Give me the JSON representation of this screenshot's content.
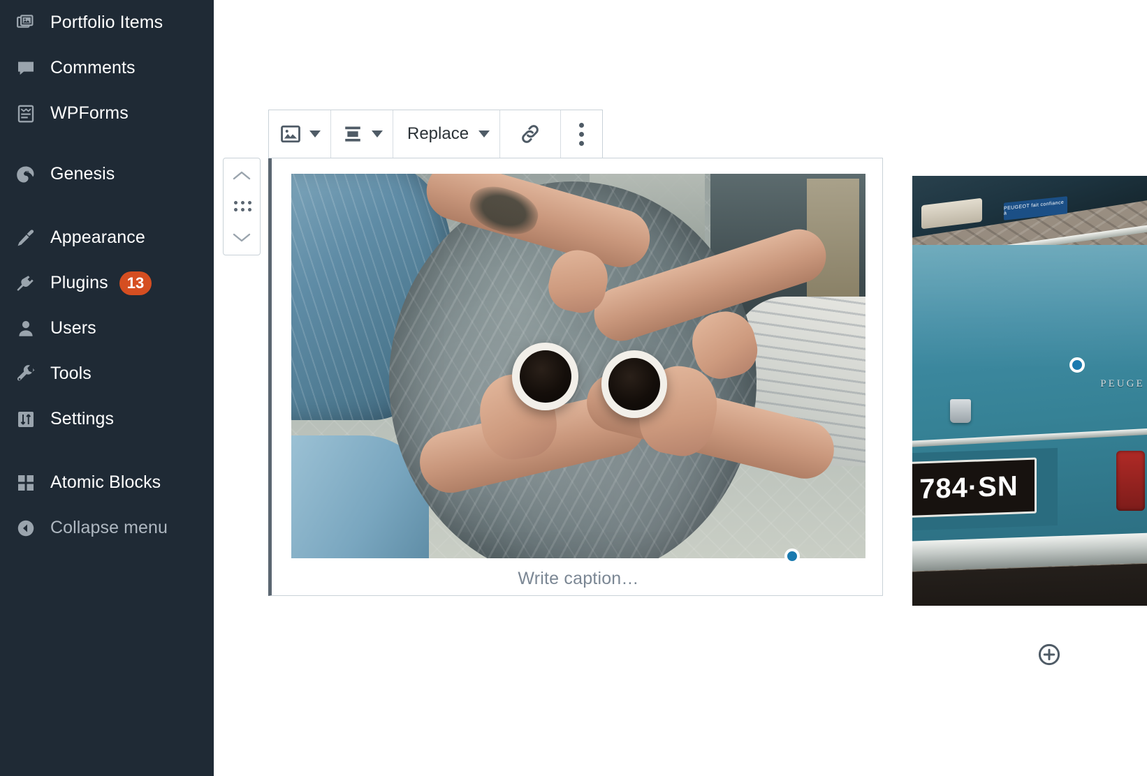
{
  "sidebar": {
    "items": [
      {
        "label": "Portfolio Items",
        "icon": "portfolio-icon",
        "badge": null
      },
      {
        "label": "Comments",
        "icon": "comments-icon",
        "badge": null
      },
      {
        "label": "WPForms",
        "icon": "wpforms-icon",
        "badge": null
      },
      {
        "label": "Genesis",
        "icon": "genesis-icon",
        "badge": null
      },
      {
        "label": "Appearance",
        "icon": "appearance-brush-icon",
        "badge": null
      },
      {
        "label": "Plugins",
        "icon": "plugins-plug-icon",
        "badge": "13"
      },
      {
        "label": "Users",
        "icon": "users-person-icon",
        "badge": null
      },
      {
        "label": "Tools",
        "icon": "tools-wrench-icon",
        "badge": null
      },
      {
        "label": "Settings",
        "icon": "settings-sliders-icon",
        "badge": null
      },
      {
        "label": "Atomic Blocks",
        "icon": "atomic-blocks-grid-icon",
        "badge": null
      },
      {
        "label": "Collapse menu",
        "icon": "collapse-arrow-icon",
        "badge": null
      }
    ],
    "badge_color": "#d54e21",
    "background_color": "#1f2a35"
  },
  "block_toolbar": {
    "block_type_label": "Image",
    "block_type_icon": "image-icon",
    "block_type_caret": "chevron-down-icon",
    "align_label": "Change alignment",
    "align_icon": "align-center-icon",
    "align_caret": "chevron-down-icon",
    "replace_label": "Replace",
    "replace_caret": "chevron-down-icon",
    "link_label": "Insert link",
    "link_icon": "link-icon",
    "more_label": "More options",
    "more_icon": "kebab-menu-icon"
  },
  "block_mover": {
    "move_up_label": "Move up",
    "move_up_icon": "chevron-up-icon",
    "drag_label": "Drag",
    "drag_icon": "drag-handle-dots-icon",
    "move_down_label": "Move down",
    "move_down_icon": "chevron-down-icon"
  },
  "image_block": {
    "caption_placeholder": "Write caption…",
    "selected": true,
    "resize_handle_color": "#1a7aaf",
    "photo_alt": "Two people holding white cups of black coffee over a round marble table"
  },
  "adjacent_image": {
    "photo_alt": "Rear of a vintage teal Peugeot car",
    "license_plate": "784·SN",
    "badge_text": "PEUGE",
    "window_sticker": "PEUGEOT fait confiance à"
  },
  "inserter": {
    "label": "Add block",
    "icon": "plus-circle-icon"
  }
}
